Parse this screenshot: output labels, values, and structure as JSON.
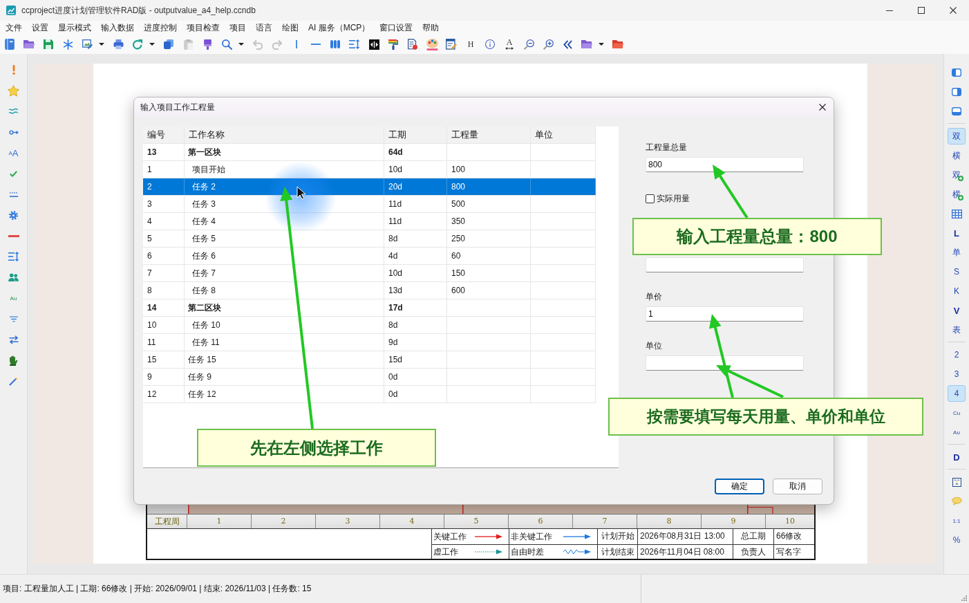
{
  "window": {
    "title": "ccproject进度计划管理软件RAD版 - outputvalue_a4_help.ccndb"
  },
  "menu": [
    "文件",
    "设置",
    "显示模式",
    "输入数据",
    "进度控制",
    "项目检查",
    "项目",
    "语言",
    "绘图",
    "AI 服务（MCP）",
    "窗口设置",
    "帮助"
  ],
  "toolbar": [
    {
      "kind": "icon",
      "disabled": false
    },
    {
      "kind": "icon",
      "disabled": false
    },
    {
      "kind": "icon",
      "disabled": false
    },
    {
      "kind": "icon",
      "disabled": false
    },
    {
      "kind": "split",
      "disabled": false
    },
    {
      "kind": "icon",
      "disabled": false
    },
    {
      "kind": "split",
      "disabled": false
    },
    {
      "kind": "icon",
      "disabled": false
    },
    {
      "kind": "icon",
      "disabled": true
    },
    {
      "kind": "icon",
      "disabled": false
    },
    {
      "kind": "split",
      "disabled": false
    },
    {
      "kind": "icon",
      "disabled": true
    },
    {
      "kind": "icon",
      "disabled": true
    },
    {
      "kind": "icon",
      "disabled": false
    },
    {
      "kind": "icon",
      "disabled": false
    },
    {
      "kind": "icon",
      "disabled": false
    },
    {
      "kind": "icon",
      "disabled": false
    },
    {
      "kind": "icon",
      "disabled": false
    },
    {
      "kind": "icon",
      "disabled": false
    },
    {
      "kind": "icon",
      "disabled": false
    },
    {
      "kind": "icon",
      "disabled": false
    },
    {
      "kind": "icon",
      "disabled": false
    },
    {
      "kind": "letter",
      "label": "H",
      "disabled": false
    },
    {
      "kind": "icon",
      "disabled": false
    },
    {
      "kind": "labeled",
      "label": "A",
      "disabled": false
    },
    {
      "kind": "icon",
      "disabled": false
    },
    {
      "kind": "icon",
      "disabled": false
    },
    {
      "kind": "icon",
      "disabled": false
    },
    {
      "kind": "split",
      "disabled": false
    },
    {
      "kind": "icon",
      "disabled": false
    }
  ],
  "left_toolbar": [
    {
      "kind": "icon"
    },
    {
      "kind": "icon"
    },
    {
      "kind": "icon"
    },
    {
      "kind": "icon"
    },
    {
      "kind": "text",
      "label": "$^{A}$A"
    },
    {
      "kind": "icon"
    },
    {
      "kind": "icon"
    },
    {
      "kind": "icon"
    },
    {
      "kind": "icon"
    },
    {
      "kind": "icon"
    },
    {
      "kind": "icon"
    },
    {
      "kind": "small",
      "label": "Au"
    },
    {
      "kind": "icon"
    },
    {
      "kind": "icon"
    },
    {
      "kind": "icon"
    },
    {
      "kind": "icon"
    }
  ],
  "right_toolbar": [
    {
      "kind": "icon",
      "selected": false
    },
    {
      "kind": "icon",
      "selected": false
    },
    {
      "kind": "icon",
      "selected": false
    },
    {
      "kind": "separator"
    },
    {
      "kind": "text",
      "label": "双",
      "selected": true,
      "bold": false,
      "badge": false
    },
    {
      "kind": "text",
      "label": "横",
      "selected": false,
      "bold": false,
      "badge": false
    },
    {
      "kind": "text",
      "label": "双",
      "selected": false,
      "bold": false,
      "badge": true
    },
    {
      "kind": "text",
      "label": "横",
      "selected": false,
      "bold": false,
      "badge": true
    },
    {
      "kind": "icon",
      "selected": false
    },
    {
      "kind": "text",
      "label": "L",
      "selected": false,
      "bold": true,
      "badge": false
    },
    {
      "kind": "text",
      "label": "单",
      "selected": false,
      "bold": false,
      "badge": false
    },
    {
      "kind": "text",
      "label": "S",
      "selected": false,
      "bold": false,
      "badge": false
    },
    {
      "kind": "text",
      "label": "K",
      "selected": false,
      "bold": false,
      "badge": false
    },
    {
      "kind": "text",
      "label": "V",
      "selected": false,
      "bold": true,
      "badge": false
    },
    {
      "kind": "text",
      "label": "表",
      "selected": false,
      "bold": false,
      "badge": false
    },
    {
      "kind": "separator"
    },
    {
      "kind": "text",
      "label": "2",
      "selected": false,
      "bold": false,
      "badge": false
    },
    {
      "kind": "text",
      "label": "3",
      "selected": false,
      "bold": false,
      "badge": false
    },
    {
      "kind": "text",
      "label": "4",
      "selected": true,
      "bold": false,
      "badge": false
    },
    {
      "kind": "small",
      "label": "Cu",
      "selected": false,
      "bold": false,
      "badge": false
    },
    {
      "kind": "small",
      "label": "Au",
      "selected": false,
      "bold": false,
      "badge": false
    },
    {
      "kind": "separator"
    },
    {
      "kind": "text",
      "label": "D",
      "selected": false,
      "bold": true,
      "badge": false
    },
    {
      "kind": "separator"
    },
    {
      "kind": "icon",
      "selected": false
    },
    {
      "kind": "icon",
      "selected": false
    },
    {
      "kind": "small",
      "label": "1:1",
      "selected": false,
      "bold": false,
      "badge": false
    },
    {
      "kind": "text",
      "label": "%",
      "selected": false,
      "bold": false,
      "badge": false
    }
  ],
  "gantt": {
    "week_label": "工程周",
    "weeks": [
      "1",
      "2",
      "3",
      "4",
      "5",
      "6",
      "7",
      "8",
      "9",
      "10"
    ],
    "legend_rows": [
      {
        "items": [
          {
            "kind": "critical",
            "label": "关键工作"
          },
          {
            "kind": "noncritical",
            "label": "非关键工作"
          }
        ],
        "fields": [
          {
            "label": "计划开始",
            "value": "2026年08月31日 13:00"
          },
          {
            "label": "总工期",
            "value": "66修改"
          }
        ]
      },
      {
        "items": [
          {
            "kind": "dummy",
            "label": "虚工作"
          },
          {
            "kind": "float",
            "label": "自由时差"
          }
        ],
        "fields": [
          {
            "label": "计划结束",
            "value": "2026年11月04日 08:00"
          },
          {
            "label": "负责人",
            "value": "写名字"
          }
        ]
      }
    ]
  },
  "dialog": {
    "title": "输入项目工作工程量",
    "table": {
      "columns": [
        "编号",
        "工作名称",
        "工期",
        "工程量",
        "单位"
      ],
      "rows": [
        {
          "id": "13",
          "name": "第一区块",
          "duration": "64d",
          "selected": false,
          "children": [
            {
              "id": "1",
              "name": "项目开始",
              "duration": "10d",
              "quantity": "100",
              "selected": false
            },
            {
              "id": "2",
              "name": "任务 2",
              "duration": "20d",
              "quantity": "800",
              "selected": true
            },
            {
              "id": "3",
              "name": "任务 3",
              "duration": "11d",
              "quantity": "500",
              "selected": false
            },
            {
              "id": "4",
              "name": "任务 4",
              "duration": "11d",
              "quantity": "350",
              "selected": false
            },
            {
              "id": "5",
              "name": "任务 5",
              "duration": "8d",
              "quantity": "250",
              "selected": false
            },
            {
              "id": "6",
              "name": "任务 6",
              "duration": "4d",
              "quantity": "60",
              "selected": false
            },
            {
              "id": "7",
              "name": "任务 7",
              "duration": "10d",
              "quantity": "150",
              "selected": false
            },
            {
              "id": "8",
              "name": "任务 8",
              "duration": "13d",
              "quantity": "600",
              "selected": false
            }
          ]
        },
        {
          "id": "14",
          "name": "第二区块",
          "duration": "17d",
          "selected": false,
          "children": [
            {
              "id": "10",
              "name": "任务 10",
              "duration": "8d",
              "selected": false
            },
            {
              "id": "11",
              "name": "任务 11",
              "duration": "9d",
              "selected": false
            }
          ]
        },
        {
          "id": "15",
          "name": "任务 15",
          "duration": "15d",
          "selected": false
        },
        {
          "id": "9",
          "name": "任务 9",
          "duration": "0d",
          "selected": false
        },
        {
          "id": "12",
          "name": "任务 12",
          "duration": "0d",
          "selected": false
        }
      ]
    },
    "form": [
      {
        "kind": "field",
        "label": "工程量总量",
        "value": "800"
      },
      {
        "kind": "checkbox",
        "label": "实际用量",
        "checked": false
      },
      {
        "kind": "field"
      },
      {
        "kind": "field",
        "label": "单价",
        "value": "1"
      },
      {
        "kind": "field",
        "label": "单位"
      }
    ],
    "buttons": [
      {
        "label": "确定",
        "default": true
      },
      {
        "label": "取消",
        "default": false
      }
    ]
  },
  "annotations": [
    {
      "text": "输入工程量总量：800"
    },
    {
      "text": "按需要填写每天用量、单价和单位"
    },
    {
      "text": "先在左侧选择工作"
    }
  ],
  "status_bar": {
    "text": "项目: 工程量加人工 | 工期: 66修改 | 开始: 2026/09/01 | 结束: 2026/11/03 | 任务数: 15"
  }
}
